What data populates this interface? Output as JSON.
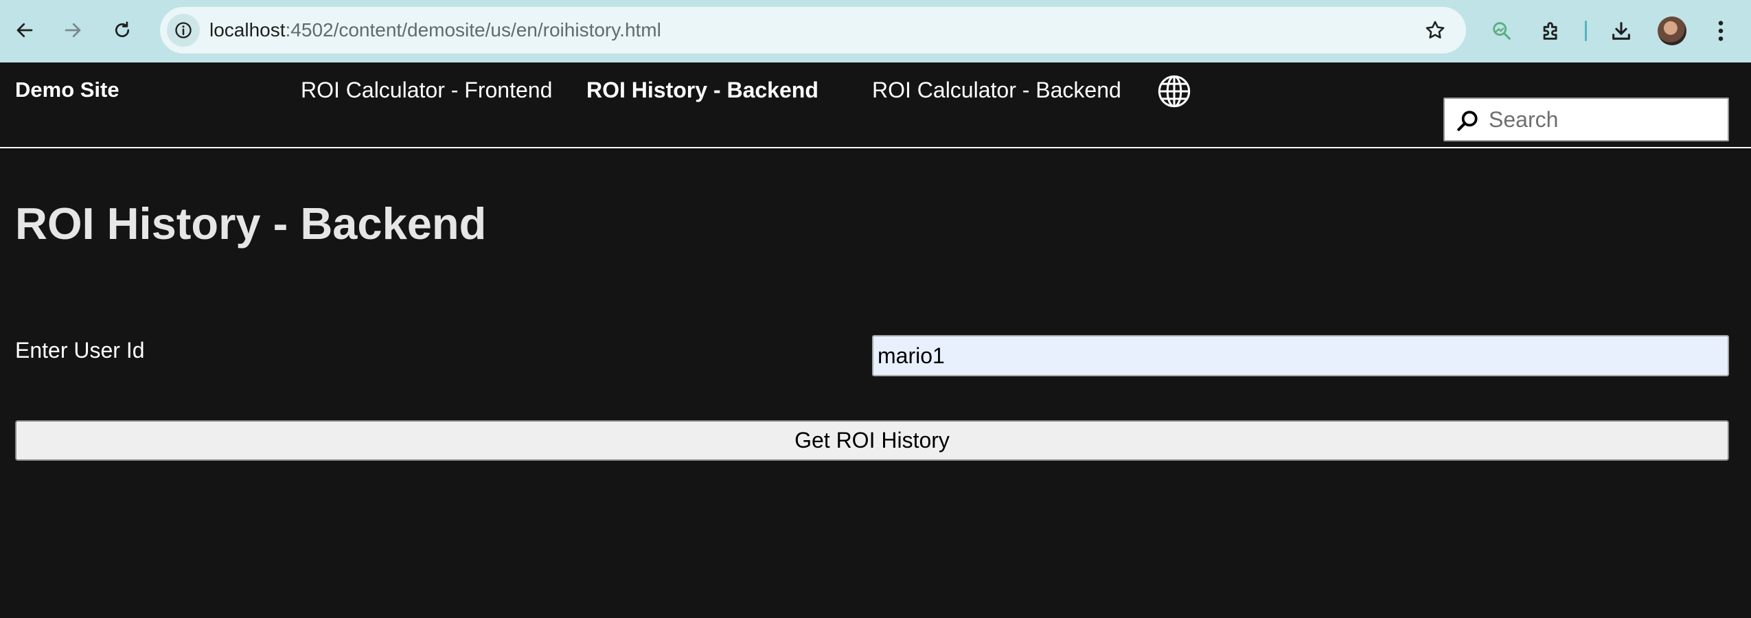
{
  "browser": {
    "url_host": "localhost",
    "url_path": ":4502/content/demosite/us/en/roihistory.html",
    "icons": [
      "back-arrow-icon",
      "forward-arrow-icon",
      "reload-icon",
      "info-icon",
      "star-icon",
      "search-labs-icon",
      "extensions-icon",
      "download-icon",
      "avatar",
      "more-menu-icon"
    ]
  },
  "nav": {
    "brand": "Demo Site",
    "items": [
      {
        "label": "ROI Calculator - Frontend",
        "active": false
      },
      {
        "label": "ROI History - Backend",
        "active": true
      },
      {
        "label": "ROI Calculator - Backend",
        "active": false
      }
    ],
    "search_placeholder": "Search"
  },
  "main": {
    "title": "ROI History - Backend",
    "user_id_label": "Enter User Id",
    "user_id_value": "mario1",
    "button_label": "Get ROI History"
  },
  "colors": {
    "chrome_bg": "#bfe3e6",
    "page_bg": "#141414",
    "input_autofill_bg": "#e8f0fe",
    "button_bg": "#efefef"
  }
}
